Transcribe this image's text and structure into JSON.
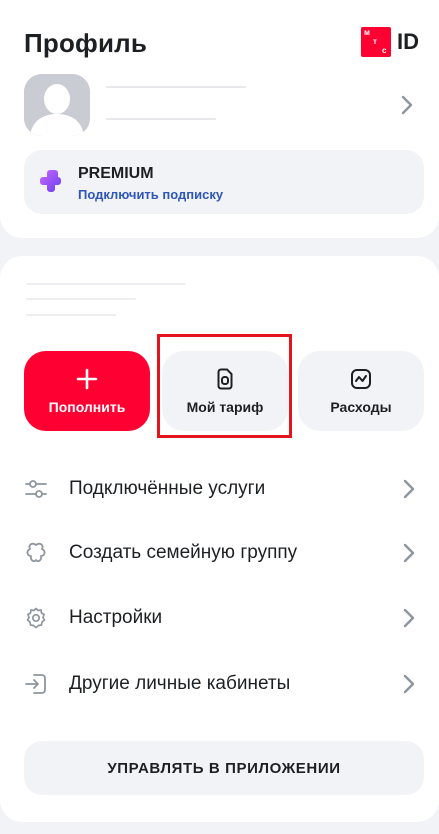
{
  "header": {
    "title": "Профиль",
    "logo_letters": [
      "м",
      "т",
      "с"
    ],
    "logo_text": "ID"
  },
  "profile": {
    "avatar_icon": "user-placeholder-icon",
    "chevron_icon": "chevron-right-icon"
  },
  "premium": {
    "title": "PREMIUM",
    "subtitle": "Подключить подписку",
    "icon": "premium-plus-icon"
  },
  "actions": [
    {
      "label": "Пополнить",
      "icon": "plus-icon"
    },
    {
      "label": "Мой тариф",
      "icon": "sim-card-icon"
    },
    {
      "label": "Расходы",
      "icon": "chart-icon"
    }
  ],
  "menu": [
    {
      "label": "Подключённые услуги",
      "icon": "sliders-icon"
    },
    {
      "label": "Создать семейную группу",
      "icon": "family-icon"
    },
    {
      "label": "Настройки",
      "icon": "gear-icon"
    },
    {
      "label": "Другие личные кабинеты",
      "icon": "login-icon"
    }
  ],
  "manage_button": "УПРАВЛЯТЬ В ПРИЛОЖЕНИИ",
  "colors": {
    "accent_red": "#ff0032",
    "link_blue": "#2e56b8",
    "background": "#f2f3f7",
    "highlight_border": "#e2141c"
  }
}
